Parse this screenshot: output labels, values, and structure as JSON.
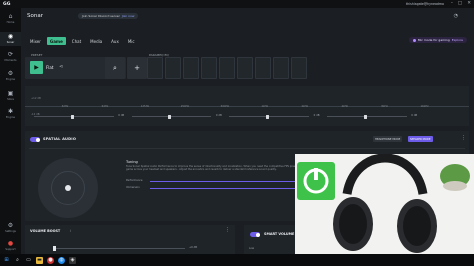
{
  "titlebar": {
    "app": "GG",
    "user": "thishlagate@hyneadmo"
  },
  "nav": [
    {
      "label": "Home",
      "icon": "home-icon",
      "glyph": "⌂"
    },
    {
      "label": "Sonar",
      "icon": "sonar-icon",
      "glyph": "◉"
    },
    {
      "label": "Moments",
      "icon": "moments-icon",
      "glyph": "⟳"
    },
    {
      "label": "Engine",
      "icon": "engine-icon",
      "glyph": "⚙"
    },
    {
      "label": "Store",
      "icon": "store-icon",
      "glyph": "▣"
    },
    {
      "label": "Engine",
      "icon": "gear-icon",
      "glyph": "✱"
    },
    {
      "label": "Downloads",
      "icon": "downloads-icon",
      "glyph": "⬇"
    },
    {
      "label": "Settings",
      "icon": "settings-icon",
      "glyph": "⚙"
    },
    {
      "label": "Support",
      "icon": "support-icon",
      "glyph": "●"
    }
  ],
  "header": {
    "title": "Sonar",
    "join_text": "Join Sonar Discord server",
    "join_link": "Join now",
    "mic_text": "Mic mode for gaming",
    "mic_link": "Explore"
  },
  "tabs": [
    "Mixer",
    "Game",
    "Chat",
    "Media",
    "Aux",
    "Mic"
  ],
  "active_tab": "Game",
  "preset": {
    "label": "PRESET",
    "name": "Flat"
  },
  "eq_label": "PARAMEQ EQ",
  "eq_db_top": "+12 dB",
  "eq_db_bottom": "-12 dB",
  "eq_freqs": [
    "32Hz",
    "64Hz",
    "125Hz",
    "250Hz",
    "500Hz",
    "1kHz",
    "2kHz",
    "4kHz",
    "8kHz",
    "16kHz"
  ],
  "eq_vals": [
    "0 dB",
    "0 dB",
    "0 dB",
    "0 dB",
    "0 dB"
  ],
  "spatial": {
    "title": "SPATIAL AUDIO",
    "mode_off": "HEADPHONE MODE",
    "mode_on": "SPEAKER MODE",
    "tuning_label": "Tuning",
    "tuning_desc": "Tune Sonar Spatial Audio Performance to improve the sense of directionality and localization. When you need the competitive FPS preset, use it for every game across your headset and speakers - Adjust the acoustics and reverb to deliver a standard reference sound quality.",
    "row1": "Performance",
    "row2": "Immersion"
  },
  "volume_boost": {
    "title": "VOLUME BOOST",
    "info": "i",
    "value": "+0 dB"
  },
  "smart_volume": {
    "title": "SMART VOLUME",
    "low": "Low"
  },
  "colors": {
    "accent_green": "#3fbf8f",
    "accent_purple": "#6c5ce7",
    "bg": "#1b1f23"
  }
}
